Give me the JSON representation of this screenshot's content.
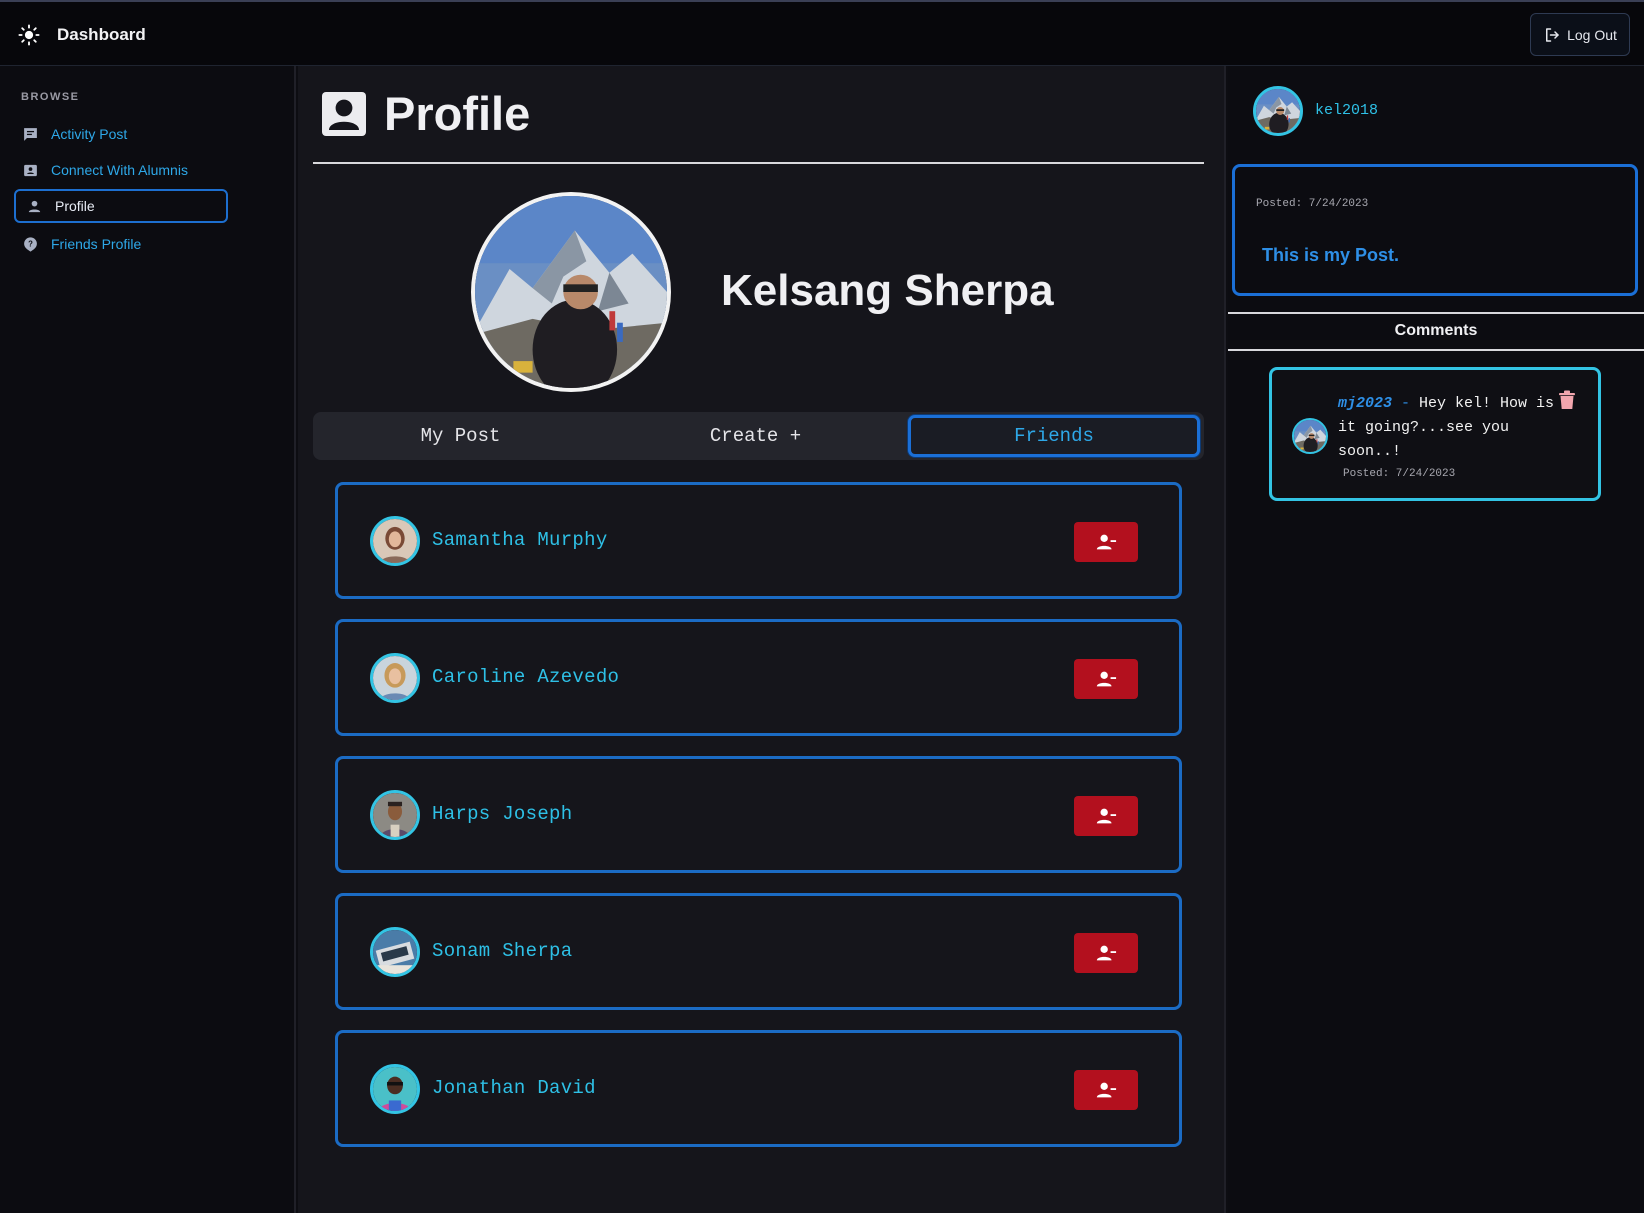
{
  "header": {
    "title": "Dashboard",
    "logout_label": "Log Out"
  },
  "sidebar": {
    "section": "BROWSE",
    "items": [
      {
        "label": "Activity Post",
        "icon": "message-icon"
      },
      {
        "label": "Connect With Alumnis",
        "icon": "contacts-icon"
      },
      {
        "label": "Profile",
        "icon": "person-icon",
        "active": true
      },
      {
        "label": "Friends Profile",
        "icon": "question-badge-icon"
      }
    ]
  },
  "main": {
    "page_title": "Profile",
    "full_name": "Kelsang Sherpa",
    "tabs": [
      {
        "label": "My Post"
      },
      {
        "label": "Create +"
      },
      {
        "label": "Friends",
        "active": true
      }
    ],
    "friends": [
      {
        "name": "Samantha Murphy"
      },
      {
        "name": "Caroline Azevedo"
      },
      {
        "name": "Harps Joseph"
      },
      {
        "name": "Sonam Sherpa"
      },
      {
        "name": "Jonathan David"
      }
    ]
  },
  "right_panel": {
    "username": "kel2018",
    "post": {
      "date": "Posted: 7/24/2023",
      "text": "This is my Post."
    },
    "comments_label": "Comments",
    "comments": [
      {
        "author": "mj2023",
        "separator": " - ",
        "text": "Hey kel! How is it going?...see you soon..!",
        "date": "Posted: 7/24/2023"
      }
    ]
  },
  "colors": {
    "accent": "#2ea8e8",
    "card_border": "#1b6bc4",
    "danger": "#b3101e",
    "avatar_ring": "#33c4e4"
  }
}
